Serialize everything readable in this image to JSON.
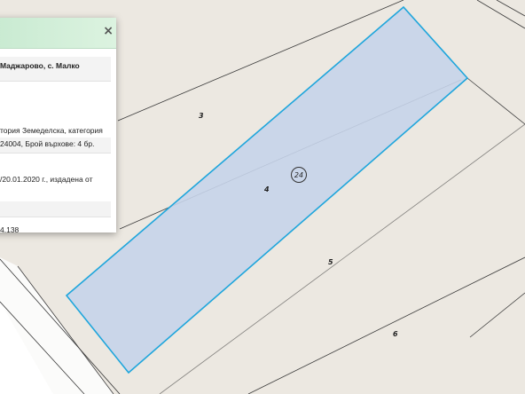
{
  "map": {
    "parcel_labels": [
      {
        "id": "parcel-3",
        "text": "3"
      },
      {
        "id": "parcel-4",
        "text": "4"
      },
      {
        "id": "parcel-5",
        "text": "5"
      },
      {
        "id": "parcel-6",
        "text": "6"
      }
    ],
    "zone_badge": "24",
    "colors": {
      "background": "#ece8e1",
      "highlight_fill": "#c6d4ea",
      "highlight_stroke": "#1fa6dc",
      "boundary": "#333333"
    }
  },
  "popup": {
    "close_icon": "×",
    "title": "Маджарово, с. Малко",
    "line1": "тория Земеделска, категория",
    "line2": "24004, Брой върхове: 4 бр.",
    "line3": "/20.01.2020  г.,  издадена  от",
    "area": "4.138"
  }
}
